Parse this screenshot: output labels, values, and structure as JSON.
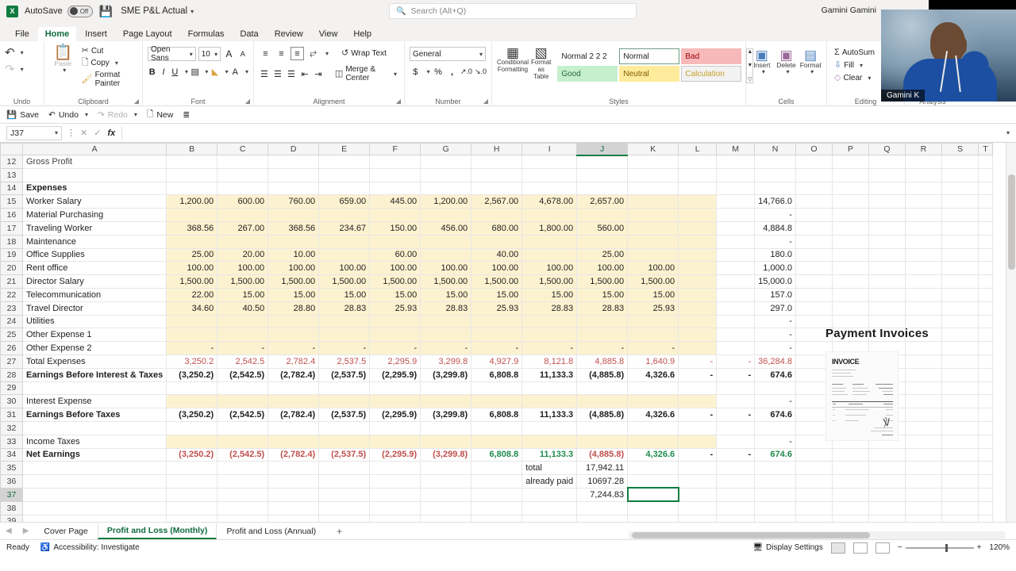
{
  "titlebar": {
    "autosave_label": "AutoSave",
    "autosave_state": "Off",
    "document_title": "SME P&L Actual",
    "search_placeholder": "Search (Alt+Q)",
    "user_name": "Gamini Gamini"
  },
  "ribbon_tabs": [
    "File",
    "Home",
    "Insert",
    "Page Layout",
    "Formulas",
    "Data",
    "Review",
    "View",
    "Help"
  ],
  "ribbon": {
    "undo": {
      "group": "Undo",
      "undo": "Undo",
      "redo": "Redo"
    },
    "clipboard": {
      "group": "Clipboard",
      "paste": "Paste",
      "cut": "Cut",
      "copy": "Copy",
      "format_painter": "Format Painter"
    },
    "font": {
      "group": "Font",
      "font_name": "Open Sans",
      "font_size": "10",
      "grow": "A",
      "shrink": "A",
      "bold": "B",
      "italic": "I",
      "underline": "U",
      "borders": "borders",
      "fill": "fill-color",
      "font_color": "A"
    },
    "alignment": {
      "group": "Alignment",
      "wrap_text": "Wrap Text",
      "merge_center": "Merge & Center"
    },
    "number": {
      "group": "Number",
      "format": "General",
      "currency": "$",
      "percent": "%",
      "comma": ","
    },
    "styles": {
      "group": "Styles",
      "conditional_formatting": "Conditional Formatting",
      "format_as_table": "Format as Table",
      "gallery": [
        "Normal 2 2 2",
        "Normal",
        "Bad",
        "Good",
        "Neutral",
        "Calculation"
      ]
    },
    "cells": {
      "group": "Cells",
      "insert": "Insert",
      "delete": "Delete",
      "format": "Format"
    },
    "editing": {
      "group": "Editing",
      "autosum": "AutoSum",
      "fill": "Fill",
      "clear": "Clear"
    },
    "analysis": {
      "group": "Analysis"
    }
  },
  "qat": {
    "save": "Save",
    "undo": "Undo",
    "redo": "Redo",
    "new": "New"
  },
  "formula_bar": {
    "name_box": "J37",
    "formula": ""
  },
  "grid": {
    "columns": [
      "A",
      "B",
      "C",
      "D",
      "E",
      "F",
      "G",
      "H",
      "I",
      "J",
      "K",
      "L",
      "M",
      "N",
      "O",
      "P",
      "Q",
      "R",
      "S",
      "T"
    ],
    "selected_column": "J",
    "selected_row": "37",
    "selected_cell": "J37",
    "rows": [
      {
        "n": "12",
        "label": "Gross Profit",
        "clipped": true,
        "values": []
      },
      {
        "n": "13",
        "label": "",
        "values": []
      },
      {
        "n": "14",
        "label": "Expenses",
        "bold": true,
        "values": []
      },
      {
        "n": "15",
        "label": "Worker Salary",
        "cream": true,
        "values": [
          "1,200.00",
          "600.00",
          "760.00",
          "659.00",
          "445.00",
          "1,200.00",
          "2,567.00",
          "4,678.00",
          "2,657.00",
          "",
          ""
        ],
        "total": "14,766.0"
      },
      {
        "n": "16",
        "label": "Material Purchasing",
        "cream": true,
        "values": [
          "",
          "",
          "",
          "",
          "",
          "",
          "",
          "",
          "",
          "",
          ""
        ],
        "total": "-"
      },
      {
        "n": "17",
        "label": "Traveling  Worker",
        "cream": true,
        "values": [
          "368.56",
          "267.00",
          "368.56",
          "234.67",
          "150.00",
          "456.00",
          "680.00",
          "1,800.00",
          "560.00",
          "",
          ""
        ],
        "total": "4,884.8"
      },
      {
        "n": "18",
        "label": "Maintenance",
        "cream": true,
        "values": [
          "",
          "",
          "",
          "",
          "",
          "",
          "",
          "",
          "",
          "",
          ""
        ],
        "total": "-"
      },
      {
        "n": "19",
        "label": "Office Supplies",
        "cream": true,
        "values": [
          "25.00",
          "20.00",
          "10.00",
          "",
          "60.00",
          "",
          "40.00",
          "",
          "25.00",
          "",
          ""
        ],
        "total": "180.0"
      },
      {
        "n": "20",
        "label": "Rent office",
        "cream": true,
        "values": [
          "100.00",
          "100.00",
          "100.00",
          "100.00",
          "100.00",
          "100.00",
          "100.00",
          "100.00",
          "100.00",
          "100.00",
          ""
        ],
        "total": "1,000.0"
      },
      {
        "n": "21",
        "label": "Director Salary",
        "cream": true,
        "values": [
          "1,500.00",
          "1,500.00",
          "1,500.00",
          "1,500.00",
          "1,500.00",
          "1,500.00",
          "1,500.00",
          "1,500.00",
          "1,500.00",
          "1,500.00",
          ""
        ],
        "total": "15,000.0"
      },
      {
        "n": "22",
        "label": "Telecommunication",
        "cream": true,
        "values": [
          "22.00",
          "15.00",
          "15.00",
          "15.00",
          "15.00",
          "15.00",
          "15.00",
          "15.00",
          "15.00",
          "15.00",
          ""
        ],
        "total": "157.0"
      },
      {
        "n": "23",
        "label": "Travel Director",
        "cream": true,
        "values": [
          "34.60",
          "40.50",
          "28.80",
          "28.83",
          "25.93",
          "28.83",
          "25.93",
          "28.83",
          "28.83",
          "25.93",
          ""
        ],
        "total": "297.0"
      },
      {
        "n": "24",
        "label": "Utilities",
        "cream": true,
        "values": [
          "",
          "",
          "",
          "",
          "",
          "",
          "",
          "",
          "",
          "",
          ""
        ],
        "total": "-"
      },
      {
        "n": "25",
        "label": "Other Expense 1",
        "cream": true,
        "values": [
          "",
          "",
          "",
          "",
          "",
          "",
          "",
          "",
          "",
          "",
          ""
        ],
        "total": "-"
      },
      {
        "n": "26",
        "label": "Other Expense 2",
        "cream": true,
        "values": [
          "-",
          "-",
          "-",
          "-",
          "-",
          "-",
          "-",
          "-",
          "-",
          "-",
          ""
        ],
        "total": "-"
      },
      {
        "n": "27",
        "label": "Total Expenses",
        "style": "red",
        "topline": true,
        "values": [
          "3,250.2",
          "2,542.5",
          "2,782.4",
          "2,537.5",
          "2,295.9",
          "3,299.8",
          "4,927.9",
          "8,121.8",
          "4,885.8",
          "1,640.9",
          "-",
          "-"
        ],
        "total": "36,284.8"
      },
      {
        "n": "28",
        "label": "Earnings Before Interest & Taxes",
        "bold": true,
        "topline": true,
        "values": [
          "(3,250.2)",
          "(2,542.5)",
          "(2,782.4)",
          "(2,537.5)",
          "(2,295.9)",
          "(3,299.8)",
          "6,808.8",
          "11,133.3",
          "(4,885.8)",
          "4,326.6",
          "-",
          "-"
        ],
        "total": "674.6"
      },
      {
        "n": "29",
        "label": "",
        "values": []
      },
      {
        "n": "30",
        "label": "Interest Expense",
        "cream": true,
        "values": [
          "",
          "",
          "",
          "",
          "",
          "",
          "",
          "",
          "",
          "",
          "",
          ""
        ],
        "total": "-"
      },
      {
        "n": "31",
        "label": "Earnings Before Taxes",
        "bold": true,
        "topline": true,
        "values": [
          "(3,250.2)",
          "(2,542.5)",
          "(2,782.4)",
          "(2,537.5)",
          "(2,295.9)",
          "(3,299.8)",
          "6,808.8",
          "11,133.3",
          "(4,885.8)",
          "4,326.6",
          "-",
          "-"
        ],
        "total": "674.6"
      },
      {
        "n": "32",
        "label": "",
        "values": []
      },
      {
        "n": "33",
        "label": "Income Taxes",
        "cream": true,
        "values": [
          "",
          "",
          "",
          "",
          "",
          "",
          "",
          "",
          "",
          "",
          "",
          ""
        ],
        "total": "-"
      },
      {
        "n": "34",
        "label": "Net Earnings",
        "bold": true,
        "topline": true,
        "colorcoded": true,
        "values": [
          "(3,250.2)",
          "(2,542.5)",
          "(2,782.4)",
          "(2,537.5)",
          "(2,295.9)",
          "(3,299.8)",
          "6,808.8",
          "11,133.3",
          "(4,885.8)",
          "4,326.6",
          "-",
          "-"
        ],
        "total": "674.6"
      },
      {
        "n": "35",
        "label": "",
        "values": []
      },
      {
        "n": "36",
        "label": "",
        "values": []
      },
      {
        "n": "37",
        "label": "",
        "values": []
      },
      {
        "n": "38",
        "label": "",
        "values": []
      },
      {
        "n": "39",
        "label": "",
        "values": []
      },
      {
        "n": "40",
        "label": "",
        "values": []
      }
    ],
    "summary": {
      "total_label": "total",
      "total_value": "17,942.11",
      "already_paid_label": "already paid",
      "already_paid_value": "10697.28",
      "balance_value": "7,244.83"
    }
  },
  "invoice_panel": {
    "title": "Payment Invoices",
    "thumb_heading": "INVOICE"
  },
  "sheet_tabs": {
    "tabs": [
      "Cover Page",
      "Profit and Loss (Monthly)",
      "Profit and Loss (Annual)"
    ],
    "active": "Profit and Loss (Monthly)",
    "add_label": "+"
  },
  "status_bar": {
    "ready": "Ready",
    "accessibility": "Accessibility: Investigate",
    "display_settings": "Display Settings",
    "zoom": "120%",
    "zoom_out": "−",
    "zoom_in": "+"
  },
  "webcam": {
    "name": "Gamini K"
  }
}
